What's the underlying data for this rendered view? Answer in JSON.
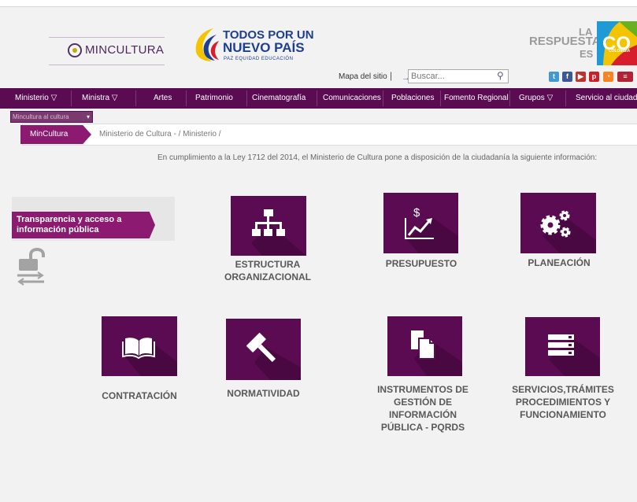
{
  "header": {
    "ministry_logo_text": "MINCULTURA",
    "gov_line1": "TODOS POR UN",
    "gov_line2": "NUEVO PAÍS",
    "gov_tagline": "PAZ  EQUIDAD  EDUCACIÓN",
    "co_line1": "LA",
    "co_line2": "RESPUESTA",
    "co_line3": "ES",
    "co_logo_text": "CO",
    "co_logo_word": "COLOMBIA",
    "site_map": "Mapa del sitio",
    "separator": "|",
    "search_placeholder": "Buscar..."
  },
  "nav": {
    "items": [
      "Ministerio ▽",
      "Ministra ▽",
      "Artes",
      "Patrimonio",
      "Cinematografía",
      "Comunicaciones",
      "Poblaciones",
      "Fomento Regional",
      "Grupos ▽",
      "Servicio al ciudadano"
    ]
  },
  "language_select": "Mincultura al cultura",
  "breadcrumb": {
    "home": "MinCultura",
    "path": "Ministerio de Cultura -  / Ministerio /"
  },
  "intro": "En cumplimiento a la Ley 1712 del 2014, el Ministerio de Cultura pone a disposición de la ciudadanía la siguiente información:",
  "transparency_label": "Transparencia y acceso a información pública",
  "tiles": [
    {
      "label": "ESTRUCTURA ORGANIZACIONAL",
      "icon": "org-chart-icon"
    },
    {
      "label": "PRESUPUESTO",
      "icon": "budget-chart-icon"
    },
    {
      "label": "PLANEACIÓN",
      "icon": "gears-icon"
    },
    {
      "label": "CONTRATACIÓN",
      "icon": "open-book-icon"
    },
    {
      "label": "NORMATIVIDAD",
      "icon": "gavel-icon"
    },
    {
      "label": "INSTRUMENTOS DE GESTIÓN DE INFORMACIÓN PÚBLICA - PQRDS",
      "icon": "documents-icon"
    },
    {
      "label": "SERVICIOS,TRÁMITES PROCEDIMIENTOS Y FUNCIONAMIENTO",
      "icon": "server-icon"
    }
  ],
  "colors": {
    "brand_purple": "#5b0b52",
    "accent_magenta": "#8b1a70",
    "gov_blue": "#1e3f91"
  }
}
